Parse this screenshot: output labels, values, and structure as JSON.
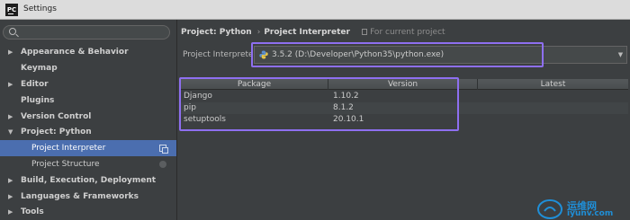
{
  "window": {
    "title": "Settings",
    "app_icon_text": "PC"
  },
  "search": {
    "placeholder": ""
  },
  "sidebar": {
    "items": [
      {
        "label": "Appearance & Behavior",
        "arrow": "▶"
      },
      {
        "label": "Keymap",
        "arrow": ""
      },
      {
        "label": "Editor",
        "arrow": "▶"
      },
      {
        "label": "Plugins",
        "arrow": ""
      },
      {
        "label": "Version Control",
        "arrow": "▶"
      },
      {
        "label": "Project: Python",
        "arrow": "▼"
      },
      {
        "label": "Project Interpreter",
        "arrow": ""
      },
      {
        "label": "Project Structure",
        "arrow": ""
      },
      {
        "label": "Build, Execution, Deployment",
        "arrow": "▶"
      },
      {
        "label": "Languages & Frameworks",
        "arrow": "▶"
      },
      {
        "label": "Tools",
        "arrow": "▶"
      }
    ]
  },
  "breadcrumb": {
    "project": "Project: Python",
    "separator": "›",
    "page": "Project Interpreter",
    "note": "For current project"
  },
  "interpreter": {
    "label": "Project Interpreter:",
    "value": "3.5.2 (D:\\Developer\\Python35\\python.exe)",
    "dropdown_glyph": "▼"
  },
  "packages_table": {
    "columns": [
      "Package",
      "Version",
      "Latest"
    ],
    "rows": [
      {
        "package": "Django",
        "version": "1.10.2",
        "latest": ""
      },
      {
        "package": "pip",
        "version": "8.1.2",
        "latest": ""
      },
      {
        "package": "setuptools",
        "version": "20.10.1",
        "latest": ""
      }
    ]
  },
  "watermark": {
    "cn": "运维网",
    "en": "iyunv.com"
  },
  "colors": {
    "background": "#3c3f41",
    "selection": "#4b6eaf",
    "annotation": "#8e6ff0",
    "watermark": "#1f8fd8"
  }
}
